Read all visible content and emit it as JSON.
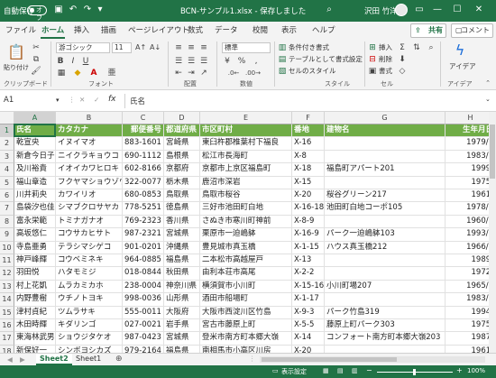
{
  "titlebar": {
    "autosave_label": "自動保存",
    "autosave_state": "オフ",
    "doc_title": "BCN-サンプル1.xlsx - 保存しました",
    "user_name": "沢田 竹洋"
  },
  "tabs": [
    "ファイル",
    "ホーム",
    "挿入",
    "描画",
    "ページレイアウト",
    "数式",
    "データ",
    "校閲",
    "表示",
    "ヘルプ"
  ],
  "active_tab": "ホーム",
  "share_label": "共有",
  "comment_label": "コメント",
  "ribbon": {
    "paste_label": "貼り付け",
    "font_name": "游ゴシック",
    "font_size": "11",
    "number_format": "標準",
    "cond_format": "条件付き書式",
    "table_format": "テーブルとして書式設定",
    "cell_style": "セルのスタイル",
    "insert": "挿入",
    "delete": "削除",
    "format": "書式",
    "ideas": "アイデア",
    "groups": [
      "クリップボード",
      "フォント",
      "配置",
      "数値",
      "スタイル",
      "セル",
      "アイデア"
    ]
  },
  "formula_bar": {
    "name_box": "A1",
    "fx": "fx",
    "content": "氏名"
  },
  "columns": [
    "A",
    "B",
    "C",
    "D",
    "E",
    "F",
    "G",
    "H"
  ],
  "header_row": [
    "氏名",
    "カタカナ",
    "郵便番号",
    "都道府県",
    "市区町村",
    "番地",
    "建物名",
    "生年月日"
  ],
  "rows": [
    [
      "乾宣央",
      "イヌイマオ",
      "883-1601",
      "宮崎県",
      "東臼杵郡椎葉村下福良",
      "X-16",
      "",
      "1979/7"
    ],
    [
      "新倉今日子",
      "ニイクラキョウコ",
      "690-1112",
      "島根県",
      "松江市長海町",
      "X-8",
      "",
      "1983/1"
    ],
    [
      "及川裕貴",
      "イオイカワヒロキ",
      "602-8166",
      "京都府",
      "京都市上京区福島町",
      "X-18",
      "福島町アパート201",
      "1999/"
    ],
    [
      "福山章造",
      "フクヤマショウゾウ",
      "322-0077",
      "栃木県",
      "鹿沼市深岩",
      "X-15",
      "",
      "1975/"
    ],
    [
      "川井莉央",
      "カワイリオ",
      "680-0853",
      "鳥取県",
      "鳥取市桜谷",
      "X-20",
      "桜谷グリーン217",
      "1961/"
    ],
    [
      "島袋汐也佳",
      "シマブクロサヤカ",
      "778-5251",
      "徳島県",
      "三好市池田町白地",
      "X-16-18",
      "池田町白地コーポ105",
      "1978/1"
    ],
    [
      "富永栄範",
      "トミナガナオ",
      "769-2323",
      "香川県",
      "さぬき市寒川町神前",
      "X-8-9",
      "",
      "1960/1"
    ],
    [
      "高坂悠仁",
      "コウサカヒサト",
      "987-2321",
      "宮城県",
      "栗原市一迫嶋躰",
      "X-16-9",
      "パーク一迫嶋躰103",
      "1993/1"
    ],
    [
      "寺島亜勇",
      "テラシマシゲコ",
      "901-0201",
      "沖縄県",
      "豊見城市真玉橋",
      "X-1-15",
      "ハウス真玉橋212",
      "1966/1"
    ],
    [
      "神戸峰輝",
      "コウベミネキ",
      "964-0885",
      "福島県",
      "二本松市高越屋戸",
      "X-13",
      "",
      "1989/"
    ],
    [
      "羽田悦",
      "ハタモミジ",
      "018-0844",
      "秋田県",
      "由利本荘市高尾",
      "X-2-2",
      "",
      "1972/"
    ],
    [
      "村上花凱",
      "ムラカミカホ",
      "238-0004",
      "神奈川県",
      "横須賀市小川町",
      "X-15-16",
      "小川町場207",
      "1965/1"
    ],
    [
      "内野豊樹",
      "ウチノトヨキ",
      "998-0036",
      "山形県",
      "酒田市船場町",
      "X-1-17",
      "",
      "1983/1"
    ],
    [
      "津村貞紀",
      "ツムラサキ",
      "555-0011",
      "大阪府",
      "大阪市西淀川区竹島",
      "X-9-3",
      "パーク竹島319",
      "1994/"
    ],
    [
      "木田時輝",
      "キダリンゴ",
      "027-0021",
      "岩手県",
      "宮古市藤原上町",
      "X-5-5",
      "藤原上町パーク303",
      "1975/"
    ],
    [
      "東海林武男",
      "ショウジタケオ",
      "987-0423",
      "宮城県",
      "登米市南方町本郷大嶺",
      "X-14",
      "コンフォート南方町本郷大嶺203",
      "1987/"
    ],
    [
      "新保好一",
      "シンボヨシカズ",
      "979-2164",
      "福島県",
      "南相馬市小高区川房",
      "X-20",
      "",
      "1961/"
    ]
  ],
  "sheets": [
    "Sheet2",
    "Sheet1"
  ],
  "active_sheet": "Sheet2",
  "status": {
    "display_settings": "表示設定",
    "zoom": "100%"
  },
  "colors": {
    "excel_green": "#217346",
    "header_fill": "#70ad47"
  }
}
